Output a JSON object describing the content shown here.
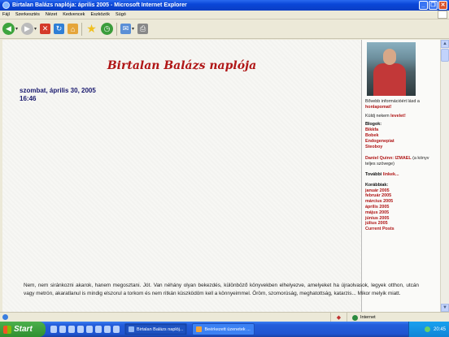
{
  "window": {
    "title": "Birtalan Balázs naplója: április 2005 - Microsoft Internet Explorer",
    "minimize_glyph": "_",
    "maximize_glyph": "❐",
    "close_glyph": "✕"
  },
  "menu": [
    "Fájl",
    "Szerkesztés",
    "Nézet",
    "Kedvencek",
    "Eszközök",
    "Súgó"
  ],
  "page": {
    "blog_title": "Birtalan Balázs naplója",
    "date": "szombat, április 30, 2005",
    "time": "16:46",
    "post_text": "Nem, nem siránkozni akarok, hanem megosztani. Jót. Van néhány olyan bekezdés, különböző könyvekben elhelyezve, amelyeket ha újraolvasok, legyek otthon, utcán vagy metrón, akaratlanul is mindig elszorul a torkom és nem ritkán küszködöm kell a könnyeimmel. Öröm, szomorúság, meghatottság, katarzis... Mikor melyik miatt."
  },
  "sidebar": {
    "more_info_text": "Bővebb információért lásd a",
    "homepage_link": "honlapomat!",
    "mail_text": "Küldj nekem",
    "mail_link": "levelet!",
    "blogs_heading": "Blogok:",
    "blogs": [
      "Bikkfa",
      "Bobek",
      "Endogenepiat",
      "Steoboy"
    ],
    "book_author": "Daniel Quinn:",
    "book_title": "IZMAEL",
    "book_note": "(a könyv teljes szövege)",
    "more_links_label": "További",
    "more_links_link": "linkek...",
    "archive_heading": "Korábbiak:",
    "archive": [
      "január 2005",
      "február 2005",
      "március 2005",
      "április 2005",
      "május 2005",
      "június 2005",
      "július 2005",
      "Current Posts"
    ]
  },
  "status": {
    "zone": "Internet"
  },
  "taskbar": {
    "start_label": "Start",
    "tasks": [
      "Birtalan Balázs naplój...",
      "Beérkezett üzenetek ..."
    ],
    "clock": "20:45"
  }
}
